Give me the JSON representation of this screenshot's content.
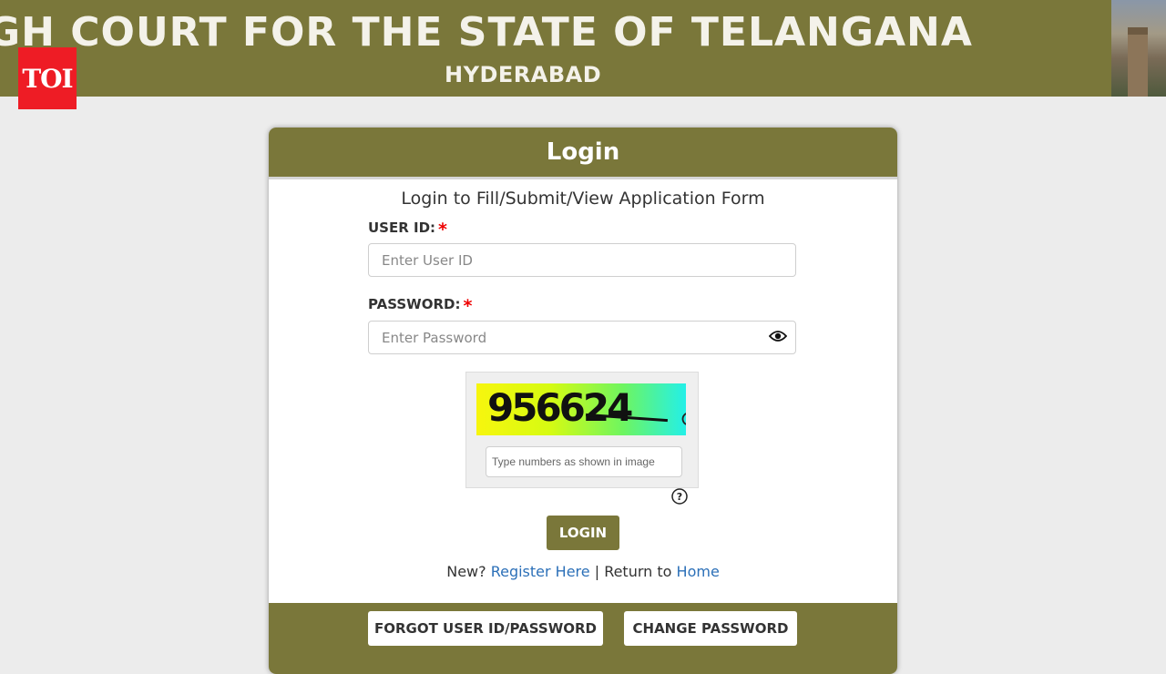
{
  "banner": {
    "title": "GH COURT FOR THE STATE OF TELANGANA",
    "subtitle": "HYDERABAD",
    "watermark": "TOI"
  },
  "login": {
    "heading": "Login",
    "subtitle": "Login to Fill/Submit/View Application Form",
    "user_id_label": "USER ID:",
    "user_id_placeholder": "Enter User ID",
    "password_label": "PASSWORD:",
    "password_placeholder": "Enter Password",
    "required_mark": "*",
    "captcha_code": "956624",
    "captcha_placeholder": "Type numbers as shown in image",
    "login_button": "LOGIN",
    "new_text": "New?",
    "register_link": "Register Here",
    "separator": "|",
    "return_text": "Return to",
    "home_link": "Home",
    "forgot_button": "FORGOT USER ID/PASSWORD",
    "change_button": "CHANGE PASSWORD"
  },
  "colors": {
    "brand": "#7a773a",
    "required": "#ee0000",
    "link": "#2c70b8",
    "watermark_bg": "#ee1c25"
  },
  "icons": [
    "eye-icon",
    "refresh-icon",
    "help-icon"
  ]
}
